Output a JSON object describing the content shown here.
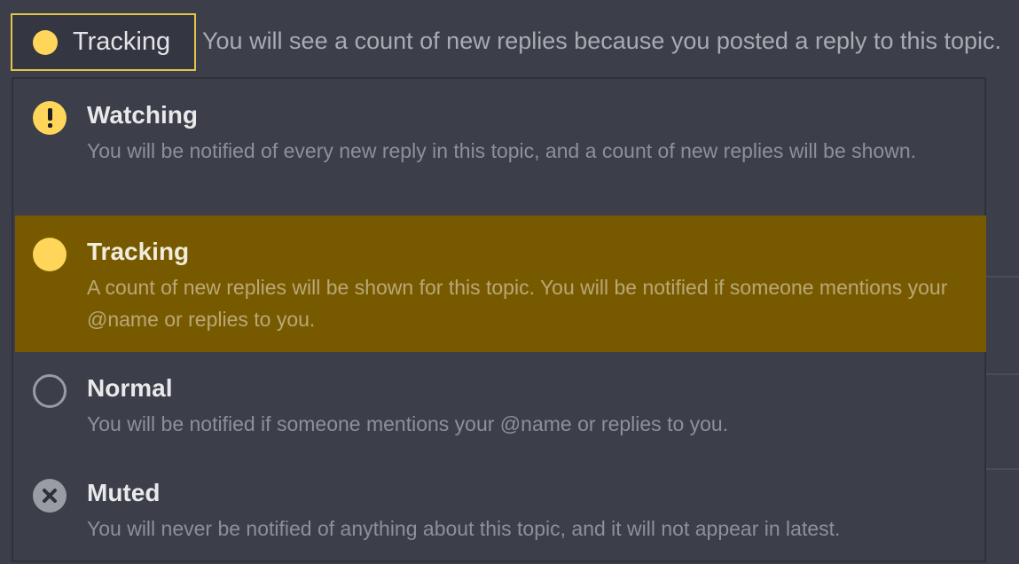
{
  "toggle": {
    "label": "Tracking",
    "icon": "circle-filled-icon",
    "color": "#ffd65a"
  },
  "reason_text": "You will see a count of new replies because you posted a reply to this topic.",
  "menu": {
    "items": [
      {
        "key": "watching",
        "title": "Watching",
        "description": "You will be notified of every new reply in this topic, and a count of new replies will be shown.",
        "icon": "exclamation-circle-icon",
        "selected": false
      },
      {
        "key": "tracking",
        "title": "Tracking",
        "description": "A count of new replies will be shown for this topic. You will be notified if someone mentions your @name or replies to you.",
        "icon": "circle-filled-icon",
        "selected": true
      },
      {
        "key": "normal",
        "title": "Normal",
        "description": "You will be notified if someone mentions your @name or replies to you.",
        "icon": "circle-outline-icon",
        "selected": false
      },
      {
        "key": "muted",
        "title": "Muted",
        "description": "You will never be notified of anything about this topic, and it will not appear in latest.",
        "icon": "times-circle-icon",
        "selected": false
      }
    ]
  },
  "colors": {
    "background": "#3c3f49",
    "accent": "#ffd65a",
    "selected_highlight": "#775a00",
    "toggle_border": "#e3c34c"
  }
}
